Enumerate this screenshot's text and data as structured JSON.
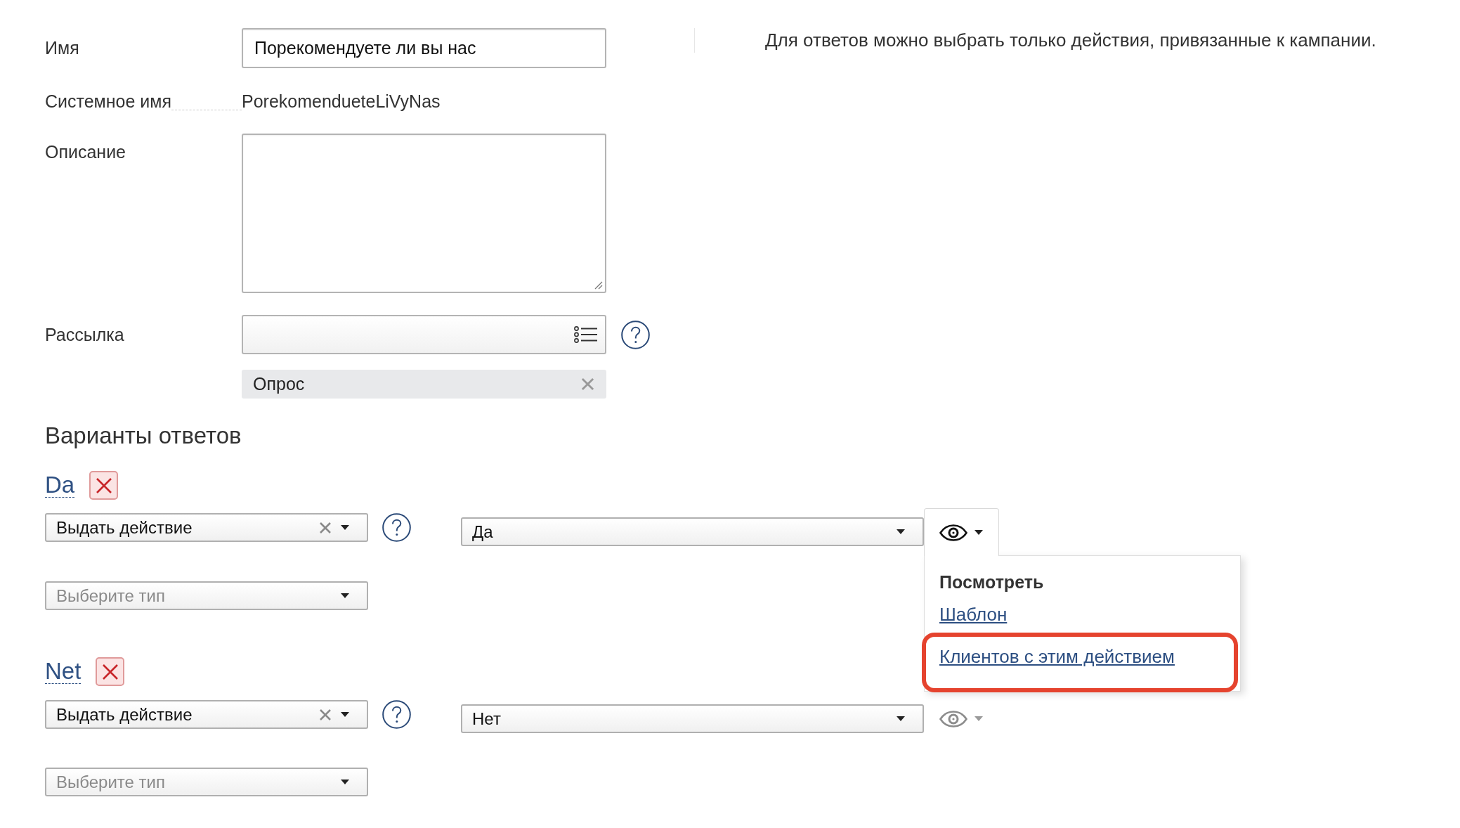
{
  "form": {
    "fields": [
      {
        "kind": "text",
        "label": "Имя",
        "value": "Порекомендуете ли вы нас"
      },
      {
        "kind": "static",
        "label": "Системное имя",
        "value": "PorekomendueteLiVyNas"
      },
      {
        "kind": "textarea",
        "label": "Описание"
      },
      {
        "kind": "picker",
        "label": "Рассылка",
        "help": true,
        "tags": [
          "Опрос"
        ]
      }
    ]
  },
  "note": "Для ответов можно выбрать только действия, привязанные к кампании.",
  "answers": {
    "title": "Варианты ответов",
    "items": [
      {
        "name": "Da",
        "mode": "Выдать действие",
        "type_placeholder": "Выберите тип",
        "action": "Да",
        "view_open": true,
        "view_menu": {
          "title": "Посмотреть",
          "links": [
            {
              "label": "Шаблон",
              "highlighted": false
            },
            {
              "label": "Клиентов с этим действием",
              "highlighted": true
            }
          ]
        }
      },
      {
        "name": "Net",
        "mode": "Выдать действие",
        "type_placeholder": "Выберите тип",
        "action": "Нет",
        "view_open": false
      }
    ]
  }
}
